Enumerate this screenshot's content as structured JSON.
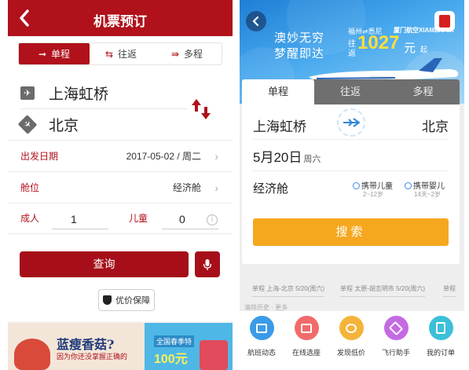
{
  "left": {
    "header": {
      "title": "机票预订"
    },
    "tabs": [
      {
        "label": "单程",
        "icon": "arrow-right-icon",
        "active": true
      },
      {
        "label": "往返",
        "icon": "swap-arrows-icon",
        "active": false
      },
      {
        "label": "多程",
        "icon": "multi-route-icon",
        "active": false
      }
    ],
    "from_city": "上海虹桥",
    "to_city": "北京",
    "date": {
      "label": "出发日期",
      "value": "2017-05-02 / 周二"
    },
    "cabin": {
      "label": "舱位",
      "value": "经济舱"
    },
    "adult": {
      "label": "成人",
      "value": "1"
    },
    "child": {
      "label": "儿童",
      "value": "0"
    },
    "query_label": "查询",
    "price_guard": "优价保障",
    "banner_left": {
      "title": "蓝瘦香菇?",
      "sub": "因为你还没掌握正确的"
    },
    "banner_right": {
      "tag": "全国春季特",
      "big": "100元"
    },
    "accent": "#b0111b"
  },
  "right": {
    "banner": {
      "slogan1": "澳妙无穷",
      "slogan2": "梦醒即达",
      "route": "福州⇌悉尼",
      "airline": "厦门航空XIAMENAIR",
      "label_wang": "往",
      "label_fan": "返",
      "price": "1027",
      "unit": "元",
      "qi": "起"
    },
    "tabs": [
      {
        "label": "单程",
        "active": true
      },
      {
        "label": "往返",
        "active": false
      },
      {
        "label": "多程",
        "active": false
      }
    ],
    "from_city": "上海虹桥",
    "to_city": "北京",
    "date": "5月20日",
    "weekday": "周六",
    "cabin": "经济舱",
    "child_opt": {
      "label": "携带儿童",
      "sub": "2~12岁"
    },
    "infant_opt": {
      "label": "携带婴儿",
      "sub": "14天~2岁"
    },
    "search_label": "搜索",
    "history": [
      "单程 上海-北京 5/20(周六)",
      "单程 太原-胡志明市 5/20(周六)",
      "单程"
    ],
    "history_more": "清除历史 · 更多",
    "quick": [
      {
        "label": "航班动态",
        "icon": "flight-status-icon",
        "color": "#3a9be8"
      },
      {
        "label": "在线选座",
        "icon": "seat-select-icon",
        "color": "#f26b6b"
      },
      {
        "label": "发现低价",
        "icon": "low-price-icon",
        "color": "#f4b43a"
      },
      {
        "label": "飞行助手",
        "icon": "flight-assistant-icon",
        "color": "#c46ae3"
      },
      {
        "label": "我的订单",
        "icon": "my-orders-icon",
        "color": "#3cc0d8"
      }
    ],
    "search_color": "#f5a81e"
  }
}
